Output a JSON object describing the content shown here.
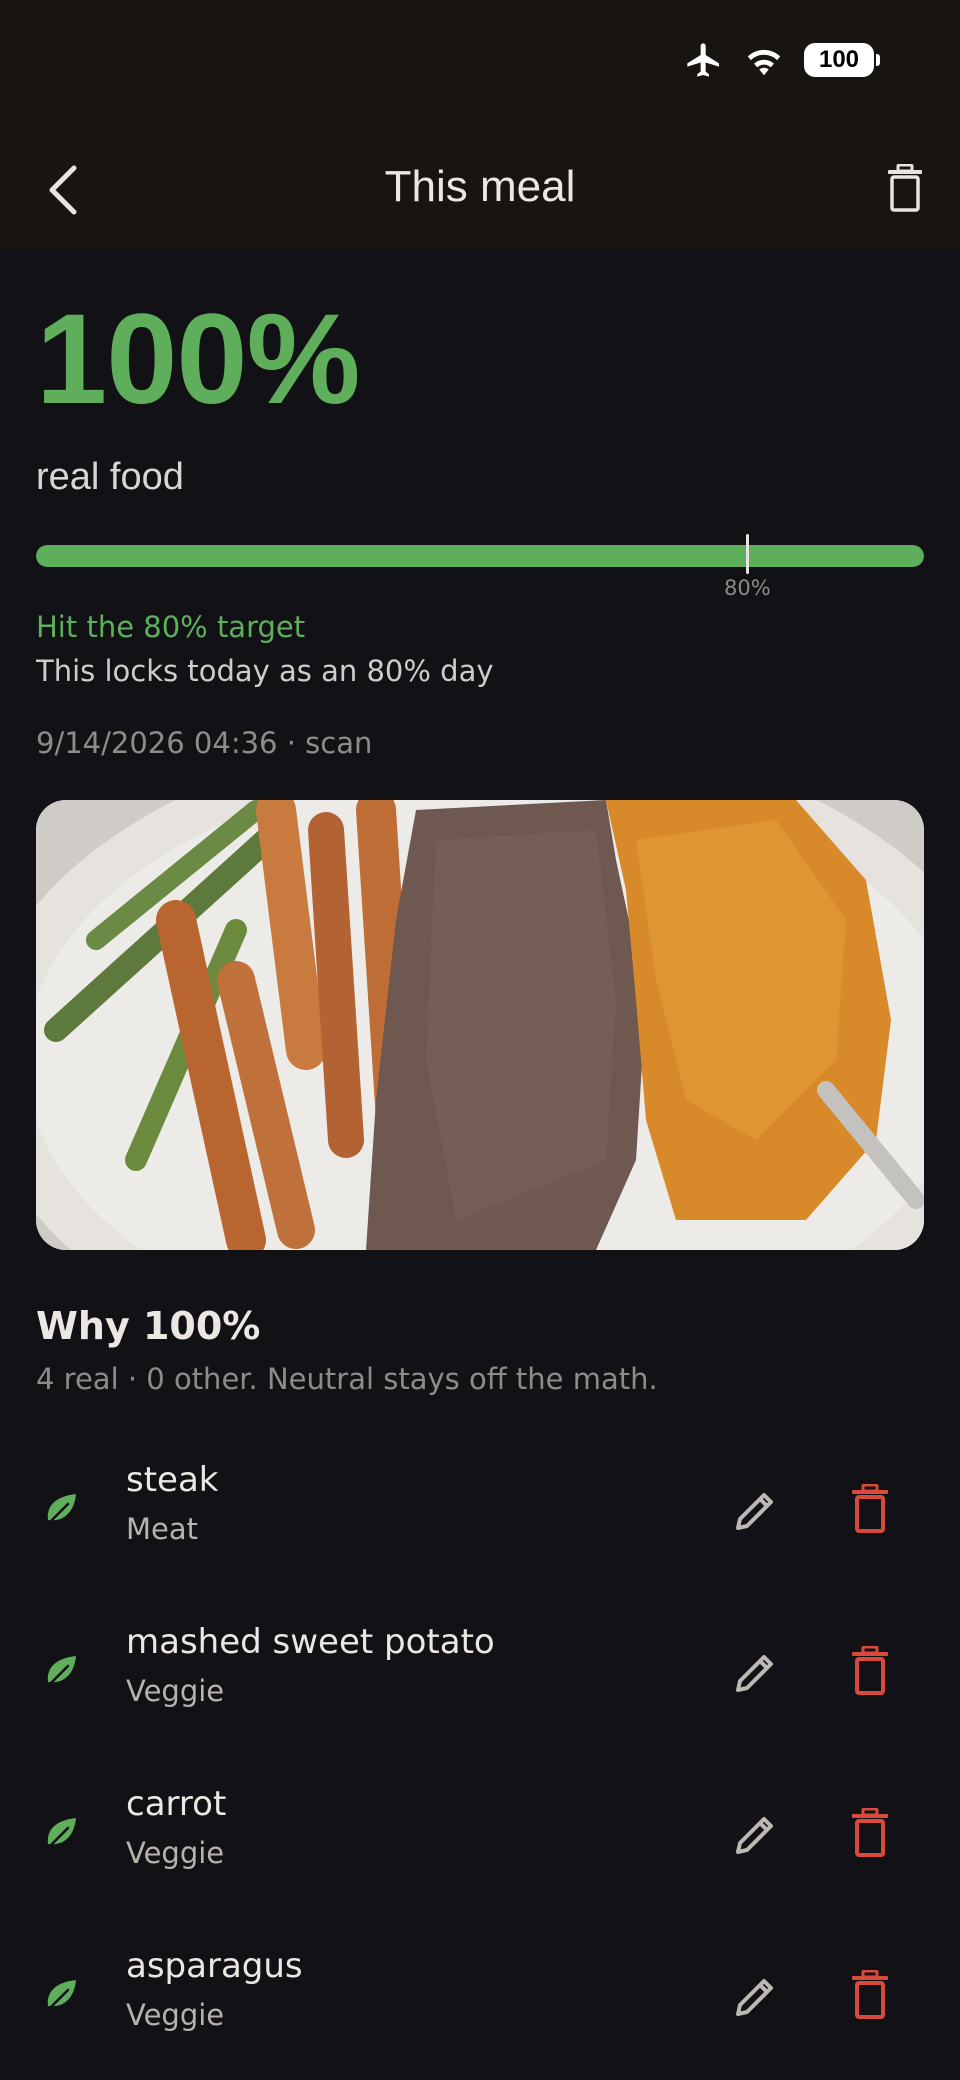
{
  "status_bar": {
    "battery": "100",
    "icons": [
      "airplane-icon",
      "wifi-icon",
      "battery-icon"
    ]
  },
  "nav": {
    "title": "This meal",
    "back_icon": "chevron-left-icon",
    "delete_icon": "trash-icon"
  },
  "summary": {
    "percent_label": "100%",
    "percent_value": 100,
    "subtitle": "real food",
    "target_marker_label": "80%",
    "target_value": 80,
    "status": "Hit the 80% target",
    "note": "This locks today as an 80% day",
    "meta": "9/14/2026  04:36 · scan"
  },
  "breakdown": {
    "title": "Why 100%",
    "subtitle": "4 real · 0 other. Neutral stays off the math.",
    "items": [
      {
        "name": "steak",
        "category": "Meat"
      },
      {
        "name": "mashed sweet potato",
        "category": "Veggie"
      },
      {
        "name": "carrot",
        "category": "Veggie"
      },
      {
        "name": "asparagus",
        "category": "Veggie"
      }
    ]
  },
  "colors": {
    "accent_green": "#5fae5c",
    "danger_red": "#d94a3d",
    "background": "#111116",
    "header": "#18140f"
  }
}
